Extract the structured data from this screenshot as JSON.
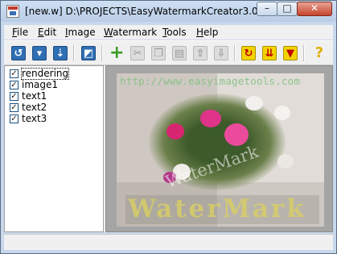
{
  "window": {
    "title": "[new.w] D:\\PROJECTS\\EasyWatermarkCreator3.0\\W...",
    "minimize_glyph": "–",
    "maximize_glyph": "□",
    "close_glyph": "✕"
  },
  "menu": [
    {
      "label": "File",
      "accel": "F"
    },
    {
      "label": "Edit",
      "accel": "E"
    },
    {
      "label": "Image",
      "accel": "I"
    },
    {
      "label": "Watermark",
      "accel": "W"
    },
    {
      "label": "Tools",
      "accel": "T"
    },
    {
      "label": "Help",
      "accel": "H"
    }
  ],
  "toolbar": {
    "buttons": [
      {
        "icon": "open-file-icon",
        "enabled": true
      },
      {
        "icon": "save-icon",
        "enabled": true
      },
      {
        "icon": "save-as-icon",
        "enabled": true
      },
      {
        "icon": "image-preview-icon",
        "enabled": true
      },
      {
        "icon": "add-layer-icon",
        "enabled": true
      },
      {
        "icon": "cut-icon",
        "enabled": false
      },
      {
        "icon": "copy-icon",
        "enabled": false
      },
      {
        "icon": "paste-icon",
        "enabled": false
      },
      {
        "icon": "move-up-icon",
        "enabled": false
      },
      {
        "icon": "move-down-icon",
        "enabled": false
      },
      {
        "icon": "process-file-icon",
        "enabled": true
      },
      {
        "icon": "batch-process-icon",
        "enabled": true
      },
      {
        "icon": "save-batch-icon",
        "enabled": true
      },
      {
        "icon": "help-icon",
        "enabled": true
      }
    ]
  },
  "layers": [
    {
      "label": "rendering",
      "checked": true,
      "selected": true
    },
    {
      "label": "image1",
      "checked": true,
      "selected": false
    },
    {
      "label": "text1",
      "checked": true,
      "selected": false
    },
    {
      "label": "text2",
      "checked": true,
      "selected": false
    },
    {
      "label": "text3",
      "checked": true,
      "selected": false
    }
  ],
  "preview": {
    "url_watermark": "http://www.easyimagetools.com",
    "diagonal_watermark": "WaterMark",
    "banner_watermark": "WaterMark",
    "banner_color": "#d9cf64",
    "url_color": "#7ec07e"
  },
  "status": {
    "text": ""
  }
}
